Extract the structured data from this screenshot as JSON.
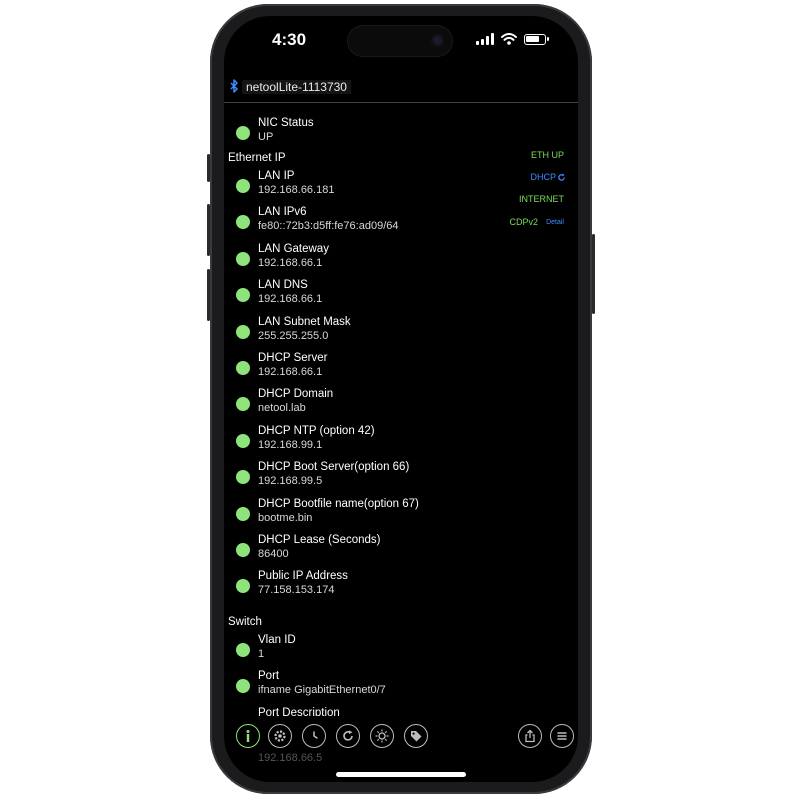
{
  "status_bar": {
    "time": "4:30"
  },
  "device": {
    "name": "netoolLite-1113730"
  },
  "nic": {
    "label": "NIC Status",
    "value": "UP"
  },
  "sections": {
    "ethernet": "Ethernet IP",
    "switch": "Switch"
  },
  "ethernet_items": [
    {
      "label": "LAN IP",
      "value": "192.168.66.181"
    },
    {
      "label": "LAN IPv6",
      "value": "fe80::72b3:d5ff:fe76:ad09/64"
    },
    {
      "label": "LAN Gateway",
      "value": "192.168.66.1"
    },
    {
      "label": "LAN DNS",
      "value": "192.168.66.1"
    },
    {
      "label": "LAN Subnet Mask",
      "value": "255.255.255.0"
    },
    {
      "label": "DHCP Server",
      "value": "192.168.66.1"
    },
    {
      "label": "DHCP Domain",
      "value": "netool.lab"
    },
    {
      "label": "DHCP NTP (option 42)",
      "value": "192.168.99.1"
    },
    {
      "label": "DHCP Boot Server(option 66)",
      "value": "192.168.99.5"
    },
    {
      "label": "DHCP Bootfile name(option 67)",
      "value": "bootme.bin"
    },
    {
      "label": "DHCP Lease (Seconds)",
      "value": "86400"
    },
    {
      "label": "Public IP Address",
      "value": " 77.158.153.174"
    }
  ],
  "switch_items": [
    {
      "label": "Vlan ID",
      "value": "1"
    },
    {
      "label": "Port",
      "value": "ifname GigabitEthernet0/7"
    },
    {
      "label": "Port Description",
      "value": ""
    }
  ],
  "switch_ghost": "192.168.66.5",
  "badges": {
    "eth_up": "ETH UP",
    "dhcp": "DHCP",
    "internet": "INTERNET",
    "cdp": "CDPv2",
    "detail": "Detail"
  },
  "colors": {
    "dot": "#8ee47b",
    "badge_green": "#7ddc5f",
    "badge_blue": "#3f8cff",
    "toolbar_active": "#8ee47b"
  },
  "toolbar_icons": [
    "info-icon",
    "gear-icon",
    "clock-icon",
    "refresh-icon",
    "sun-icon",
    "tag-icon",
    "share-icon",
    "list-icon"
  ]
}
